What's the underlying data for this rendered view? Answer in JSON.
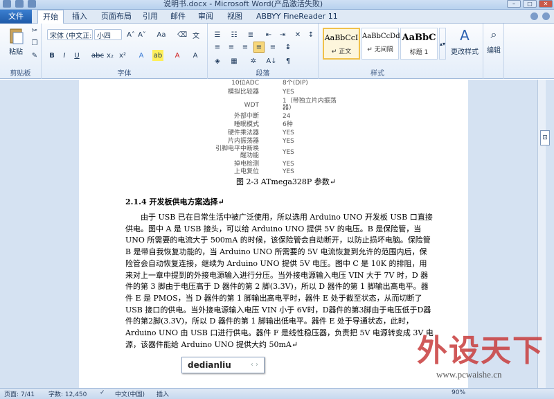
{
  "window": {
    "title": "说明书.docx - Microsoft Word(产品激活失败)"
  },
  "tabs": [
    "文件",
    "开始",
    "插入",
    "页面布局",
    "引用",
    "邮件",
    "审阅",
    "视图",
    "ABBYY FineReader 11"
  ],
  "ribbon": {
    "clipboard": {
      "paste": "粘贴",
      "label": "剪贴板"
    },
    "font": {
      "name": "宋体 (中文正:",
      "size": "小四",
      "label": "字体"
    },
    "paragraph": {
      "label": "段落"
    },
    "styles": {
      "items": [
        {
          "preview": "AaBbCcI",
          "name": "↵ 正文"
        },
        {
          "preview": "AaBbCcDd",
          "name": "↵ 无间隔"
        },
        {
          "preview": "AaBbC",
          "name": "标题 1"
        }
      ],
      "change": "更改样式",
      "label": "样式"
    },
    "edit": {
      "label": "编辑"
    }
  },
  "spec_table": [
    {
      "k": "10位ADC",
      "v": "8个(DIP)"
    },
    {
      "k": "模拟比较器",
      "v": "YES"
    },
    {
      "k": "WDT",
      "v": "1（带独立片内振荡器）"
    },
    {
      "k": "外部中断",
      "v": "24"
    },
    {
      "k": "睡眠模式",
      "v": "6种"
    },
    {
      "k": "硬件乘法器",
      "v": "YES"
    },
    {
      "k": "片内振荡器",
      "v": "YES"
    },
    {
      "k": "引脚电平中断唤醒功能",
      "v": "YES"
    },
    {
      "k": "掉电检测",
      "v": "YES"
    },
    {
      "k": "上电复位",
      "v": "YES"
    }
  ],
  "document": {
    "caption": "图 2-3 ATmega328P 参数↵",
    "heading": "2.1.4 开发板供电方案选择↵",
    "paragraph": "由于 USB 已在日常生活中被广泛使用，所以选用 Arduino UNO 开发板 USB 口直接供电。图中 A 是 USB 接头，可以给 Arduino UNO 提供 5V 的电压。B 是保险管，当 UNO 所需要的电流大于 500mA 的时候，该保险管会自动断开，以防止损坏电脑。保险管 B 是带自我恢复功能的，当 Arduino UNO 所需要的 5V 电流恢复到允许的范围内后，保险管会自动恢复连接，继续为 Arduino UNO 提供 5V 电压。图中 C 是 10K 的排阻，用来对上一章中提到的外接电源输入进行分压。当外接电源输入电压 VIN 大于 7V 时，D 器件的第 3 脚由于电压高于 D 器件的第 2 脚(3.3V)，所以 D 器件的第 1 脚输出高电平。器件 E 是 PMOS，当 D 器件的第 1 脚输出高电平时，器件 E 处于截至状态，从而切断了 USB 接口的供电。当外接电源输入电压 VIN 小于 6V时，D器件的第3脚由于电压低于D器件的第2脚(3.3V)，所以 D 器件的第 1 脚输出低电平。器件 E 处于导通状态，此时，Arduino UNO 由 USB 口进行供电。器件 F 是线性稳压器，负责把 5V 电源转变成 3V 电源，该器件能给 Arduino UNO 提供大约 50mA↵"
  },
  "ime": {
    "text": "dedianliu",
    "arrows": "‹ ›"
  },
  "status": {
    "page": "页面: 7/41",
    "words": "字数: 12,450",
    "lang": "中文(中国)",
    "mode": "插入",
    "zoom": "90%"
  },
  "watermark": {
    "brand": "外设天下",
    "url": "www.pcwaishe.cn"
  }
}
